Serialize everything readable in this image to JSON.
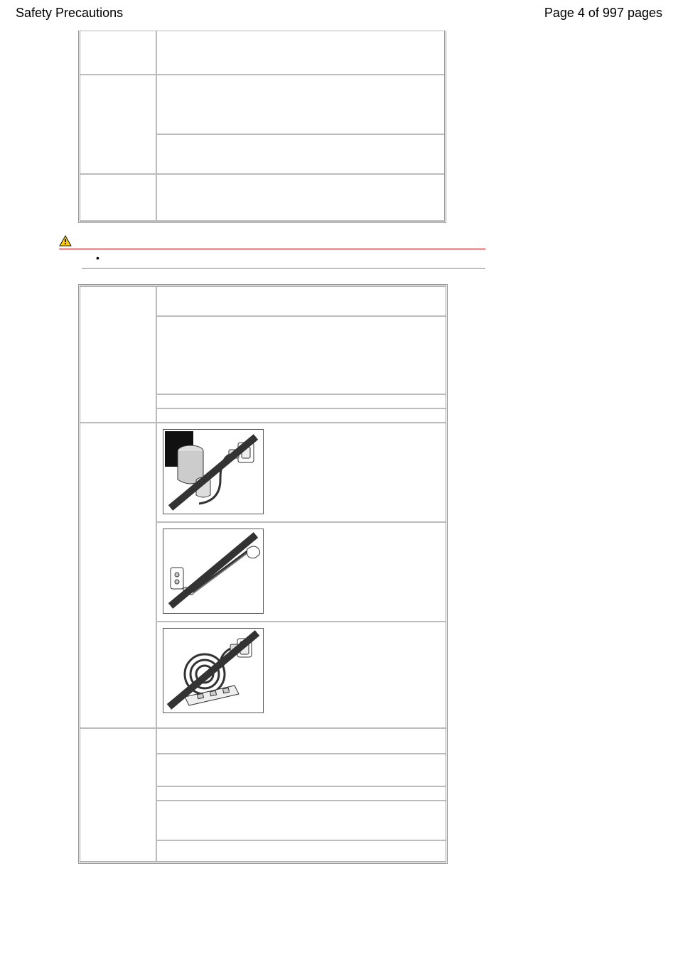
{
  "header": {
    "title_left": "Safety Precautions",
    "title_right": "Page 4 of 997 pages"
  },
  "table1": {
    "rows": [
      {
        "c1": "",
        "c2": ""
      },
      {
        "c1": "",
        "c2a": "",
        "c2b": ""
      },
      {
        "c1": "",
        "c2": ""
      }
    ]
  },
  "warning": {
    "icon": "warning-icon",
    "label": "",
    "bullet": "•"
  },
  "table2": {
    "illustrations": [
      {
        "name": "power-plug-objects-illustration"
      },
      {
        "name": "pulling-cord-illustration"
      },
      {
        "name": "coiled-cord-adapter-illustration"
      }
    ],
    "rows": []
  }
}
